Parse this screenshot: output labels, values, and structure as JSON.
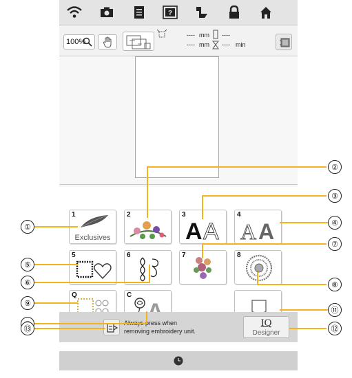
{
  "toolbar": {
    "zoom_label": "100%",
    "size_width": "----",
    "size_width_unit": "mm",
    "size_height": "----",
    "size_height_unit": "mm",
    "time_top": "----",
    "time_value": "----",
    "time_unit": "min"
  },
  "categories": [
    {
      "num": "1",
      "label": "Exclusives"
    },
    {
      "num": "2",
      "label": ""
    },
    {
      "num": "3",
      "label": ""
    },
    {
      "num": "4",
      "label": ""
    },
    {
      "num": "5",
      "label": ""
    },
    {
      "num": "6",
      "label": ""
    },
    {
      "num": "7",
      "label": ""
    },
    {
      "num": "8",
      "label": ""
    },
    {
      "num": "Q",
      "label": ""
    },
    {
      "num": "C",
      "label": ""
    }
  ],
  "message": {
    "line1": "Always press when",
    "line2": "removing embroidery unit."
  },
  "iq_designer": {
    "title": "IQ",
    "subtitle": "Designer"
  },
  "callouts": [
    "①",
    "②",
    "③",
    "④",
    "⑤",
    "⑥",
    "⑦",
    "⑧",
    "⑨",
    "⑩",
    "⑪",
    "⑫",
    "⑬"
  ],
  "colors": {
    "callout_line": "#f2b31c",
    "top_bar": "#e4e4e4"
  }
}
